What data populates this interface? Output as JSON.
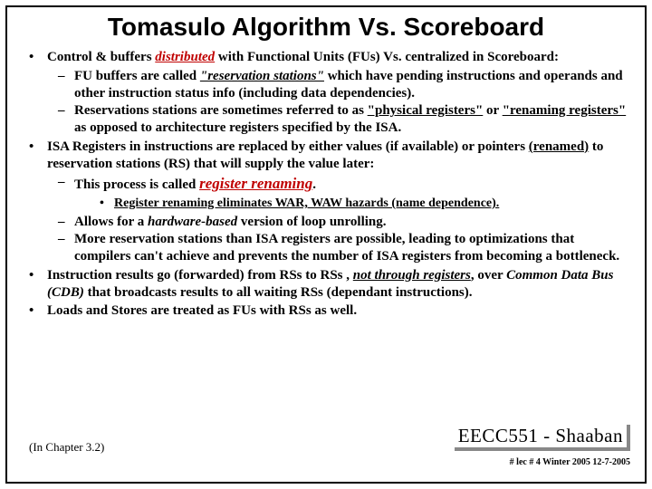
{
  "title": "Tomasulo Algorithm Vs. Scoreboard",
  "b1": {
    "pre": "Control & buffers ",
    "word": "distributed",
    "post": " with Functional Units (FUs) Vs. centralized in Scoreboard:",
    "s1a": "FU buffers are called ",
    "s1q": "\"reservation stations\"",
    "s1b": " which have pending instructions and operands and other instruction status info (including data dependencies).",
    "s2a": "Reservations stations are sometimes referred to as ",
    "s2q1": "\"physical registers\"",
    "s2mid": " or ",
    "s2q2": "\"renaming registers\"",
    "s2b": " as opposed to architecture registers specified by the ISA."
  },
  "b2": {
    "a": "ISA Registers in instructions are replaced by either values (if available) or pointers ",
    "renamed": "(renamed)",
    "b": " to reservation stations (RS) that will supply the value later:",
    "s1a": "This process is called ",
    "s1word": "register renaming",
    "s1dot": ".",
    "ss1": "Register renaming eliminates WAR, WAW hazards (name dependence).",
    "s2a": "Allows for a ",
    "s2word": "hardware-based",
    "s2b": " version of loop unrolling.",
    "s3": "More reservation stations than ISA registers are possible, leading to optimizations that compilers can't achieve and prevents the number of ISA registers from becoming a bottleneck."
  },
  "b3": {
    "a": "Instruction results go (forwarded) from RSs to RSs , ",
    "word": "not through registers",
    "b": ", over ",
    "cdb": "Common Data Bus (CDB)",
    "c": " that broadcasts results to all waiting RSs (dependant instructions)."
  },
  "b4": "Loads and Stores are treated as FUs with RSs as well.",
  "chapter": "(In Chapter 3.2)",
  "sig": "EECC551 - Shaaban",
  "meta": "# lec # 4  Winter 2005    12-7-2005"
}
